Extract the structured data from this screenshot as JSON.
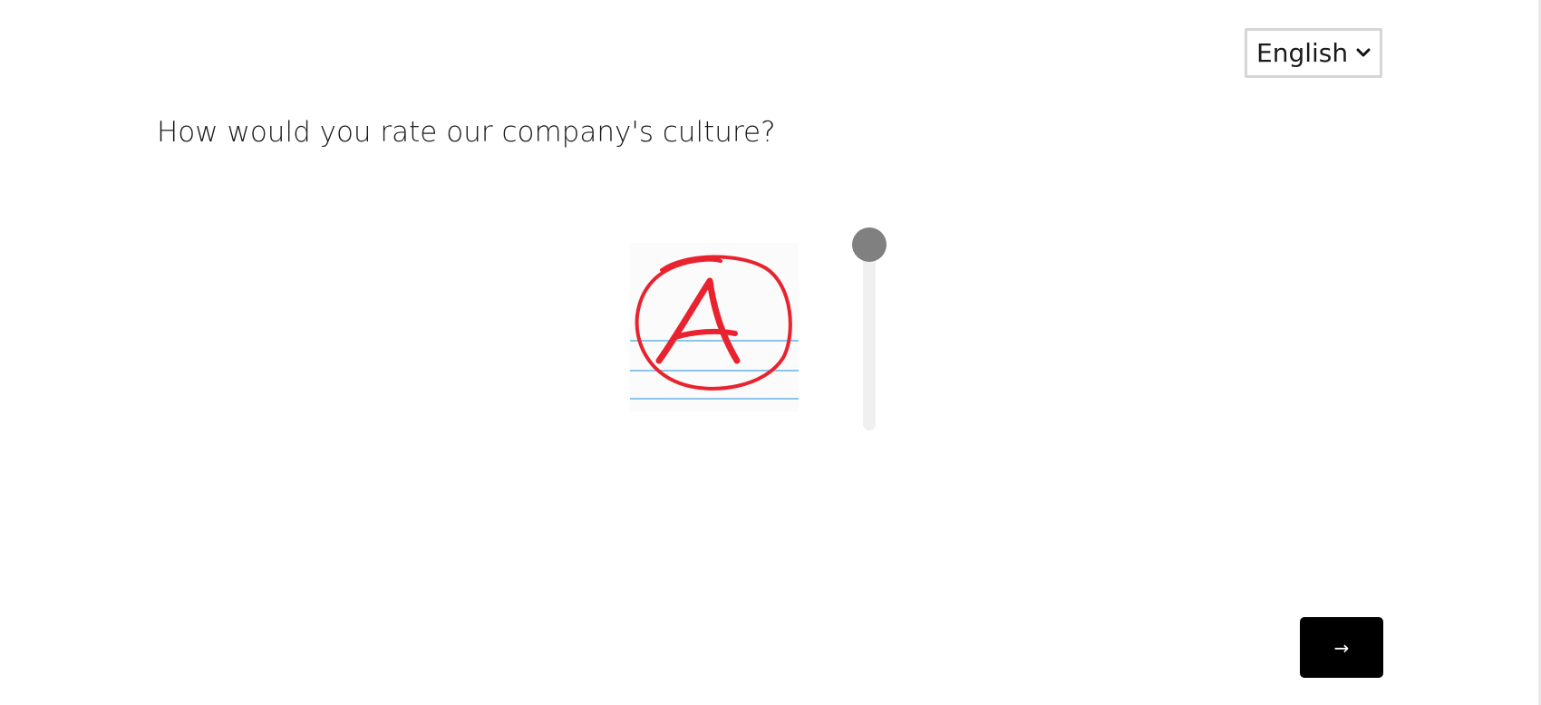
{
  "language_select": {
    "selected": "English"
  },
  "question": {
    "text": "How would you rate our company's culture?"
  },
  "rating_image": {
    "letter": "A",
    "alt": "letter grade image",
    "ink_color": "#e8232f",
    "ruled_line_color": "#8cc4ea"
  },
  "rating_slider": {
    "value_fraction": 1.0,
    "thumb_color": "#808080",
    "track_color": "#f0f0f0"
  },
  "next_button": {
    "label": "→",
    "background": "#000000"
  }
}
